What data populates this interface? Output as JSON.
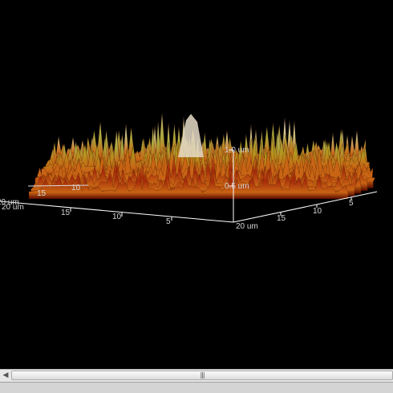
{
  "viewer": {
    "background": "#000000",
    "axis_color": "#ffffff",
    "surface_colors": [
      "#5a0a00",
      "#a52a0a",
      "#c86414",
      "#b4961e",
      "#aaa83c",
      "#c8bc78",
      "#e6dcc8"
    ],
    "x_axis": {
      "ticks": [
        "20 um",
        "15",
        "10",
        "5"
      ]
    },
    "y_axis": {
      "ticks": [
        "20 um",
        "15",
        "10",
        "5"
      ]
    },
    "z_axis": {
      "ticks": [
        "1.0 um",
        "0.5 um"
      ]
    },
    "back_axis": {
      "ticks": [
        "15",
        "10"
      ],
      "end_label": "20 um"
    }
  },
  "scrollbar": {
    "left_arrow": "◀",
    "grip": "|||"
  }
}
